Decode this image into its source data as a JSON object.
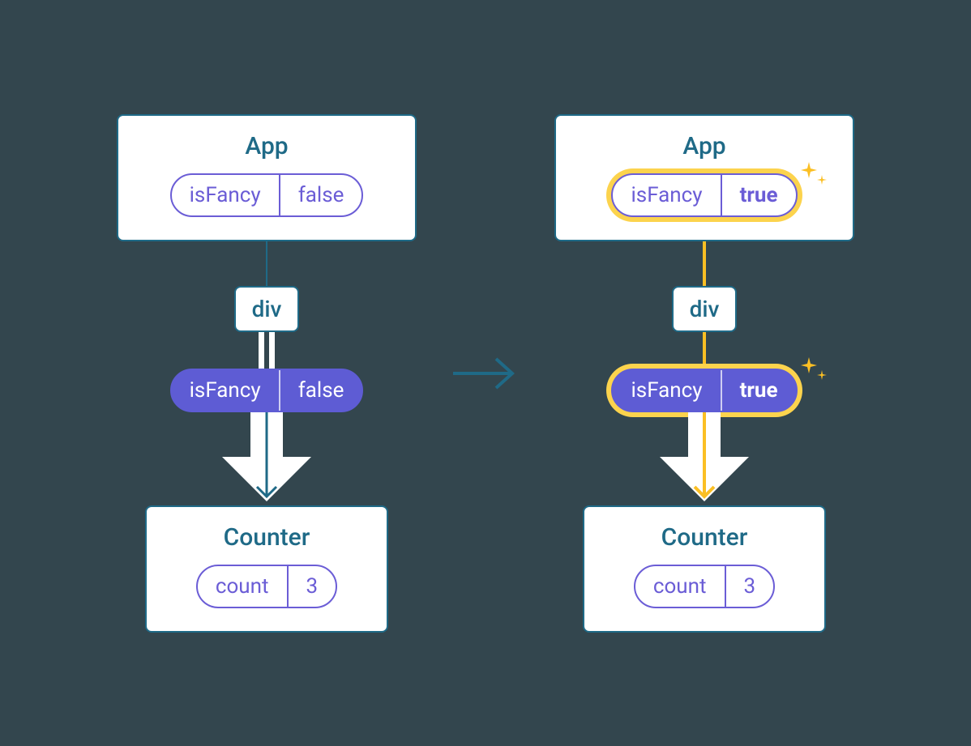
{
  "left": {
    "app": {
      "title": "App",
      "prop": "isFancy",
      "value": "false"
    },
    "div": "div",
    "passed": {
      "prop": "isFancy",
      "value": "false"
    },
    "counter": {
      "title": "Counter",
      "prop": "count",
      "value": "3"
    }
  },
  "right": {
    "app": {
      "title": "App",
      "prop": "isFancy",
      "value": "true"
    },
    "div": "div",
    "passed": {
      "prop": "isFancy",
      "value": "true"
    },
    "counter": {
      "title": "Counter",
      "prop": "count",
      "value": "3"
    }
  }
}
